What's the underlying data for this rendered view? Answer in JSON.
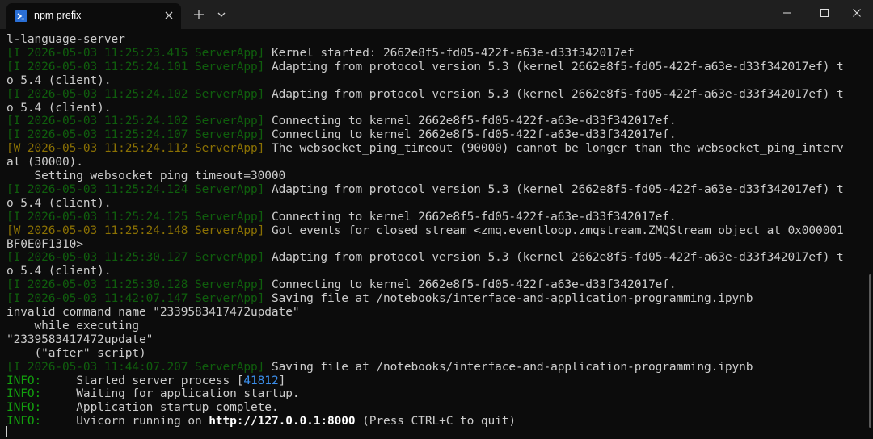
{
  "window": {
    "tab_title": "npm prefix",
    "tab_icon": "powershell-icon",
    "new_tab_icon": "plus-icon",
    "dropdown_icon": "chevron-down-icon",
    "controls": [
      "minimize-icon",
      "maximize-icon",
      "close-icon"
    ]
  },
  "colors": {
    "background": "#0c0c0c",
    "titlebar": "#1f1f1f",
    "text": "#cccccc",
    "info_green": "#13a10e",
    "warn_yellow": "#c19c00",
    "pid_blue": "#3b8eea"
  },
  "terminal": {
    "lines": [
      {
        "text": "l-language-server"
      },
      {
        "prefix": "[I 2026-05-03 11:25:23.415 ServerApp]",
        "level": "I",
        "text": " Kernel started: 2662e8f5-fd05-422f-a63e-d33f342017ef"
      },
      {
        "prefix": "[I 2026-05-03 11:25:24.101 ServerApp]",
        "level": "I",
        "text": " Adapting from protocol version 5.3 (kernel 2662e8f5-fd05-422f-a63e-d33f342017ef) t"
      },
      {
        "text": "o 5.4 (client)."
      },
      {
        "prefix": "[I 2026-05-03 11:25:24.102 ServerApp]",
        "level": "I",
        "text": " Adapting from protocol version 5.3 (kernel 2662e8f5-fd05-422f-a63e-d33f342017ef) t"
      },
      {
        "text": "o 5.4 (client)."
      },
      {
        "prefix": "[I 2026-05-03 11:25:24.102 ServerApp]",
        "level": "I",
        "text": " Connecting to kernel 2662e8f5-fd05-422f-a63e-d33f342017ef."
      },
      {
        "prefix": "[I 2026-05-03 11:25:24.107 ServerApp]",
        "level": "I",
        "text": " Connecting to kernel 2662e8f5-fd05-422f-a63e-d33f342017ef."
      },
      {
        "prefix": "[W 2026-05-03 11:25:24.112 ServerApp]",
        "level": "W",
        "text": " The websocket_ping_timeout (90000) cannot be longer than the websocket_ping_interv"
      },
      {
        "text": "al (30000)."
      },
      {
        "text": "    Setting websocket_ping_timeout=30000"
      },
      {
        "prefix": "[I 2026-05-03 11:25:24.124 ServerApp]",
        "level": "I",
        "text": " Adapting from protocol version 5.3 (kernel 2662e8f5-fd05-422f-a63e-d33f342017ef) t"
      },
      {
        "text": "o 5.4 (client)."
      },
      {
        "prefix": "[I 2026-05-03 11:25:24.125 ServerApp]",
        "level": "I",
        "text": " Connecting to kernel 2662e8f5-fd05-422f-a63e-d33f342017ef."
      },
      {
        "prefix": "[W 2026-05-03 11:25:24.148 ServerApp]",
        "level": "W",
        "text": " Got events for closed stream <zmq.eventloop.zmqstream.ZMQStream object at 0x000001"
      },
      {
        "text": "BF0E0F1310>"
      },
      {
        "prefix": "[I 2026-05-03 11:25:30.127 ServerApp]",
        "level": "I",
        "text": " Adapting from protocol version 5.3 (kernel 2662e8f5-fd05-422f-a63e-d33f342017ef) t"
      },
      {
        "text": "o 5.4 (client)."
      },
      {
        "prefix": "[I 2026-05-03 11:25:30.128 ServerApp]",
        "level": "I",
        "text": " Connecting to kernel 2662e8f5-fd05-422f-a63e-d33f342017ef."
      },
      {
        "prefix": "[I 2026-05-03 11:42:07.147 ServerApp]",
        "level": "I",
        "text": " Saving file at /notebooks/interface-and-application-programming.ipynb"
      },
      {
        "text": "invalid command name \"2339583417472update\""
      },
      {
        "text": "    while executing"
      },
      {
        "text": "\"2339583417472update\""
      },
      {
        "text": "    (\"after\" script)"
      },
      {
        "prefix": "[I 2026-05-03 11:44:07.207 ServerApp]",
        "level": "I",
        "text": " Saving file at /notebooks/interface-and-application-programming.ipynb"
      },
      {
        "info": "INFO:",
        "text": "     Started server process [",
        "pid": "41812",
        "suffix": "]"
      },
      {
        "info": "INFO:",
        "text": "     Waiting for application startup."
      },
      {
        "info": "INFO:",
        "text": "     Application startup complete."
      },
      {
        "info": "INFO:",
        "text": "     Uvicorn running on ",
        "url": "http://127.0.0.1:8000",
        "suffix": " (Press CTRL+C to quit)"
      }
    ]
  }
}
